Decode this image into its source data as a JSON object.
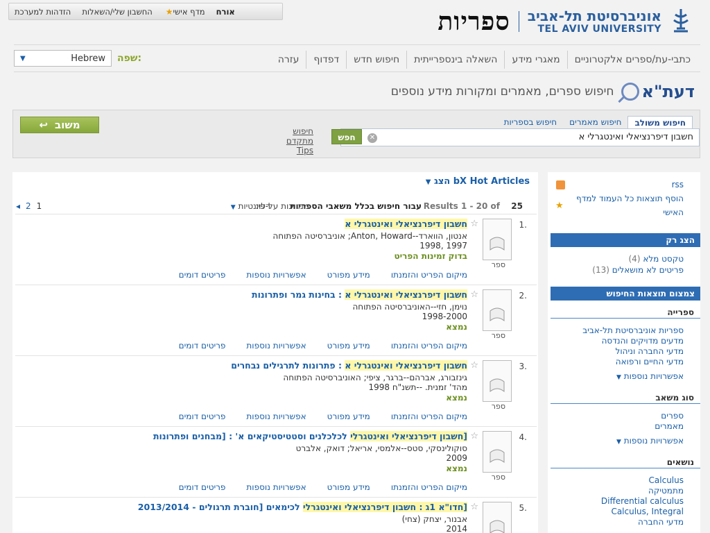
{
  "userbar": {
    "guest": "אורח",
    "shelf": "מדף אישי",
    "account": "החשבון שלי/השאלות",
    "login": "הזדהות למערכת"
  },
  "logo": {
    "title": "ספריות",
    "he": "אוניברסיטת תל-אביב",
    "en": "TEL AVIV UNIVERSITY"
  },
  "nav": {
    "items": [
      "כתבי-עת/ספרים אלקטרוניים",
      "מאגרי מידע",
      "השאלה בינספרייתית",
      "חיפוש חדש",
      "דפדוף",
      "עזרה"
    ]
  },
  "language": {
    "label": "שפה:",
    "value": "Hebrew"
  },
  "header": {
    "logo_text": "דעת\"א",
    "tagline": "חיפוש ספרים, מאמרים ומקורות מידע נוספים"
  },
  "search": {
    "tabs": [
      "חיפוש משולב",
      "חיפוש מאמרים",
      "חיפוש בספריות"
    ],
    "query": "חשבון דיפרנציאלי ואינטגרלי א",
    "go": "חפש",
    "advanced": "חיפוש מתקדם",
    "tips": "Tips",
    "feedback": "משוב"
  },
  "bx": "bX Hot Articles הצג",
  "resultsbar": {
    "count": "25",
    "range": "Results 1 - 20 of",
    "scope": "עבור חיפוש בכלל משאבי הספריות",
    "sort_label": "ממויינות על-פי:",
    "sort_value": "רלוונטיות",
    "pages": [
      "1",
      "2"
    ]
  },
  "results": [
    {
      "num": "1.",
      "type": "ספר",
      "title_hl": "חשבון דיפרנציאלי ואינטגרלי א",
      "title_rest": "",
      "lines": [
        "אנטון, הווארד--Anton, Howard; אוניברסיטה הפתוחה",
        "1997 ,1998"
      ],
      "avail": "בדוק זמינות הפריט"
    },
    {
      "num": "2.",
      "type": "ספר",
      "title_hl": "חשבון דיפרנציאלי ואינטגרלי א",
      "title_rest": " : בחינות גמר ופתרונות",
      "lines": [
        "נוימן, חזי--האוניברסיטה הפתוחה",
        "1998-2000"
      ],
      "avail": "נמצא"
    },
    {
      "num": "3.",
      "type": "ספר",
      "title_hl": "חשבון דיפרנציאלי ואינטגרלי א",
      "title_rest": " : פתרונות לתרגילים נבחרים",
      "lines": [
        "גינזבורג, אברהם--ברגר, ציפי; האוניברסיטה הפתוחה",
        "מהד' זמנית. --תשנ\"ח 1998"
      ],
      "avail": "נמצא"
    },
    {
      "num": "4.",
      "type": "ספר",
      "title_hl": "[חשבון דיפרנציאלי ואינטגרלי",
      "title_rest": " לכלכלנים וסטטיסטיקאים א' : [מבחנים ופתרונות",
      "lines": [
        "סוקולינסקי, סטס--אלמסי, אריאל; דואק, אלברט",
        "2009"
      ],
      "avail": "נמצא"
    },
    {
      "num": "5.",
      "type": "ספר",
      "title_hl": "[חדו\"א 1ג : חשבון דיפרנציאלי ואינטגרלי",
      "title_rest": " לכימאים [חוברת תרגולים - 2013/2014",
      "lines": [
        "אבנור, יצחק (צחי)",
        "2014"
      ],
      "avail": ""
    }
  ],
  "item_links": [
    "מיקום הפריט והזמנתו",
    "מידע מפורט",
    "אפשרויות נוספות",
    "פריטים דומים"
  ],
  "side": {
    "rss": "rss",
    "add_all": "הוסף תוצאות כל העמוד למדף",
    "personal": "האישי",
    "show_only": "הצג רק",
    "fulltext": "טקסט מלא",
    "fulltext_cnt": "(4)",
    "unloaned": "פריטים לא מושאלים",
    "unloaned_cnt": "(13)",
    "narrow": "צמצום תוצאות החיפוש",
    "library": "ספרייה",
    "libs": [
      "ספריות אוניברסיטת תל-אביב",
      "מדעים מדויקים והנדסה",
      "מדעי החברה וניהול",
      "מדעי החיים ורפואה"
    ],
    "more1": "אפשרויות נוספות",
    "source_type": "סוג משאב",
    "types": [
      "ספרים",
      "מאמרים"
    ],
    "more2": "אפשרויות נוספות",
    "subjects": "נושאים",
    "subject_list": [
      "Calculus",
      "מתמטיקה",
      "Differential calculus",
      "Calculus, Integral",
      "מדעי החברה"
    ]
  }
}
